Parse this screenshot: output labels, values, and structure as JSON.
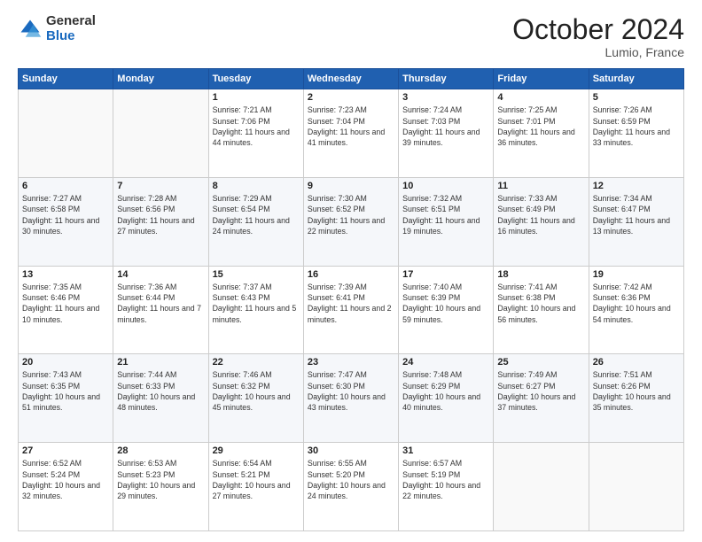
{
  "header": {
    "logo_general": "General",
    "logo_blue": "Blue",
    "month_title": "October 2024",
    "location": "Lumio, France"
  },
  "days_of_week": [
    "Sunday",
    "Monday",
    "Tuesday",
    "Wednesday",
    "Thursday",
    "Friday",
    "Saturday"
  ],
  "weeks": [
    [
      {
        "day": "",
        "info": ""
      },
      {
        "day": "",
        "info": ""
      },
      {
        "day": "1",
        "sunrise": "Sunrise: 7:21 AM",
        "sunset": "Sunset: 7:06 PM",
        "daylight": "Daylight: 11 hours and 44 minutes."
      },
      {
        "day": "2",
        "sunrise": "Sunrise: 7:23 AM",
        "sunset": "Sunset: 7:04 PM",
        "daylight": "Daylight: 11 hours and 41 minutes."
      },
      {
        "day": "3",
        "sunrise": "Sunrise: 7:24 AM",
        "sunset": "Sunset: 7:03 PM",
        "daylight": "Daylight: 11 hours and 39 minutes."
      },
      {
        "day": "4",
        "sunrise": "Sunrise: 7:25 AM",
        "sunset": "Sunset: 7:01 PM",
        "daylight": "Daylight: 11 hours and 36 minutes."
      },
      {
        "day": "5",
        "sunrise": "Sunrise: 7:26 AM",
        "sunset": "Sunset: 6:59 PM",
        "daylight": "Daylight: 11 hours and 33 minutes."
      }
    ],
    [
      {
        "day": "6",
        "sunrise": "Sunrise: 7:27 AM",
        "sunset": "Sunset: 6:58 PM",
        "daylight": "Daylight: 11 hours and 30 minutes."
      },
      {
        "day": "7",
        "sunrise": "Sunrise: 7:28 AM",
        "sunset": "Sunset: 6:56 PM",
        "daylight": "Daylight: 11 hours and 27 minutes."
      },
      {
        "day": "8",
        "sunrise": "Sunrise: 7:29 AM",
        "sunset": "Sunset: 6:54 PM",
        "daylight": "Daylight: 11 hours and 24 minutes."
      },
      {
        "day": "9",
        "sunrise": "Sunrise: 7:30 AM",
        "sunset": "Sunset: 6:52 PM",
        "daylight": "Daylight: 11 hours and 22 minutes."
      },
      {
        "day": "10",
        "sunrise": "Sunrise: 7:32 AM",
        "sunset": "Sunset: 6:51 PM",
        "daylight": "Daylight: 11 hours and 19 minutes."
      },
      {
        "day": "11",
        "sunrise": "Sunrise: 7:33 AM",
        "sunset": "Sunset: 6:49 PM",
        "daylight": "Daylight: 11 hours and 16 minutes."
      },
      {
        "day": "12",
        "sunrise": "Sunrise: 7:34 AM",
        "sunset": "Sunset: 6:47 PM",
        "daylight": "Daylight: 11 hours and 13 minutes."
      }
    ],
    [
      {
        "day": "13",
        "sunrise": "Sunrise: 7:35 AM",
        "sunset": "Sunset: 6:46 PM",
        "daylight": "Daylight: 11 hours and 10 minutes."
      },
      {
        "day": "14",
        "sunrise": "Sunrise: 7:36 AM",
        "sunset": "Sunset: 6:44 PM",
        "daylight": "Daylight: 11 hours and 7 minutes."
      },
      {
        "day": "15",
        "sunrise": "Sunrise: 7:37 AM",
        "sunset": "Sunset: 6:43 PM",
        "daylight": "Daylight: 11 hours and 5 minutes."
      },
      {
        "day": "16",
        "sunrise": "Sunrise: 7:39 AM",
        "sunset": "Sunset: 6:41 PM",
        "daylight": "Daylight: 11 hours and 2 minutes."
      },
      {
        "day": "17",
        "sunrise": "Sunrise: 7:40 AM",
        "sunset": "Sunset: 6:39 PM",
        "daylight": "Daylight: 10 hours and 59 minutes."
      },
      {
        "day": "18",
        "sunrise": "Sunrise: 7:41 AM",
        "sunset": "Sunset: 6:38 PM",
        "daylight": "Daylight: 10 hours and 56 minutes."
      },
      {
        "day": "19",
        "sunrise": "Sunrise: 7:42 AM",
        "sunset": "Sunset: 6:36 PM",
        "daylight": "Daylight: 10 hours and 54 minutes."
      }
    ],
    [
      {
        "day": "20",
        "sunrise": "Sunrise: 7:43 AM",
        "sunset": "Sunset: 6:35 PM",
        "daylight": "Daylight: 10 hours and 51 minutes."
      },
      {
        "day": "21",
        "sunrise": "Sunrise: 7:44 AM",
        "sunset": "Sunset: 6:33 PM",
        "daylight": "Daylight: 10 hours and 48 minutes."
      },
      {
        "day": "22",
        "sunrise": "Sunrise: 7:46 AM",
        "sunset": "Sunset: 6:32 PM",
        "daylight": "Daylight: 10 hours and 45 minutes."
      },
      {
        "day": "23",
        "sunrise": "Sunrise: 7:47 AM",
        "sunset": "Sunset: 6:30 PM",
        "daylight": "Daylight: 10 hours and 43 minutes."
      },
      {
        "day": "24",
        "sunrise": "Sunrise: 7:48 AM",
        "sunset": "Sunset: 6:29 PM",
        "daylight": "Daylight: 10 hours and 40 minutes."
      },
      {
        "day": "25",
        "sunrise": "Sunrise: 7:49 AM",
        "sunset": "Sunset: 6:27 PM",
        "daylight": "Daylight: 10 hours and 37 minutes."
      },
      {
        "day": "26",
        "sunrise": "Sunrise: 7:51 AM",
        "sunset": "Sunset: 6:26 PM",
        "daylight": "Daylight: 10 hours and 35 minutes."
      }
    ],
    [
      {
        "day": "27",
        "sunrise": "Sunrise: 6:52 AM",
        "sunset": "Sunset: 5:24 PM",
        "daylight": "Daylight: 10 hours and 32 minutes."
      },
      {
        "day": "28",
        "sunrise": "Sunrise: 6:53 AM",
        "sunset": "Sunset: 5:23 PM",
        "daylight": "Daylight: 10 hours and 29 minutes."
      },
      {
        "day": "29",
        "sunrise": "Sunrise: 6:54 AM",
        "sunset": "Sunset: 5:21 PM",
        "daylight": "Daylight: 10 hours and 27 minutes."
      },
      {
        "day": "30",
        "sunrise": "Sunrise: 6:55 AM",
        "sunset": "Sunset: 5:20 PM",
        "daylight": "Daylight: 10 hours and 24 minutes."
      },
      {
        "day": "31",
        "sunrise": "Sunrise: 6:57 AM",
        "sunset": "Sunset: 5:19 PM",
        "daylight": "Daylight: 10 hours and 22 minutes."
      },
      {
        "day": "",
        "info": ""
      },
      {
        "day": "",
        "info": ""
      }
    ]
  ]
}
